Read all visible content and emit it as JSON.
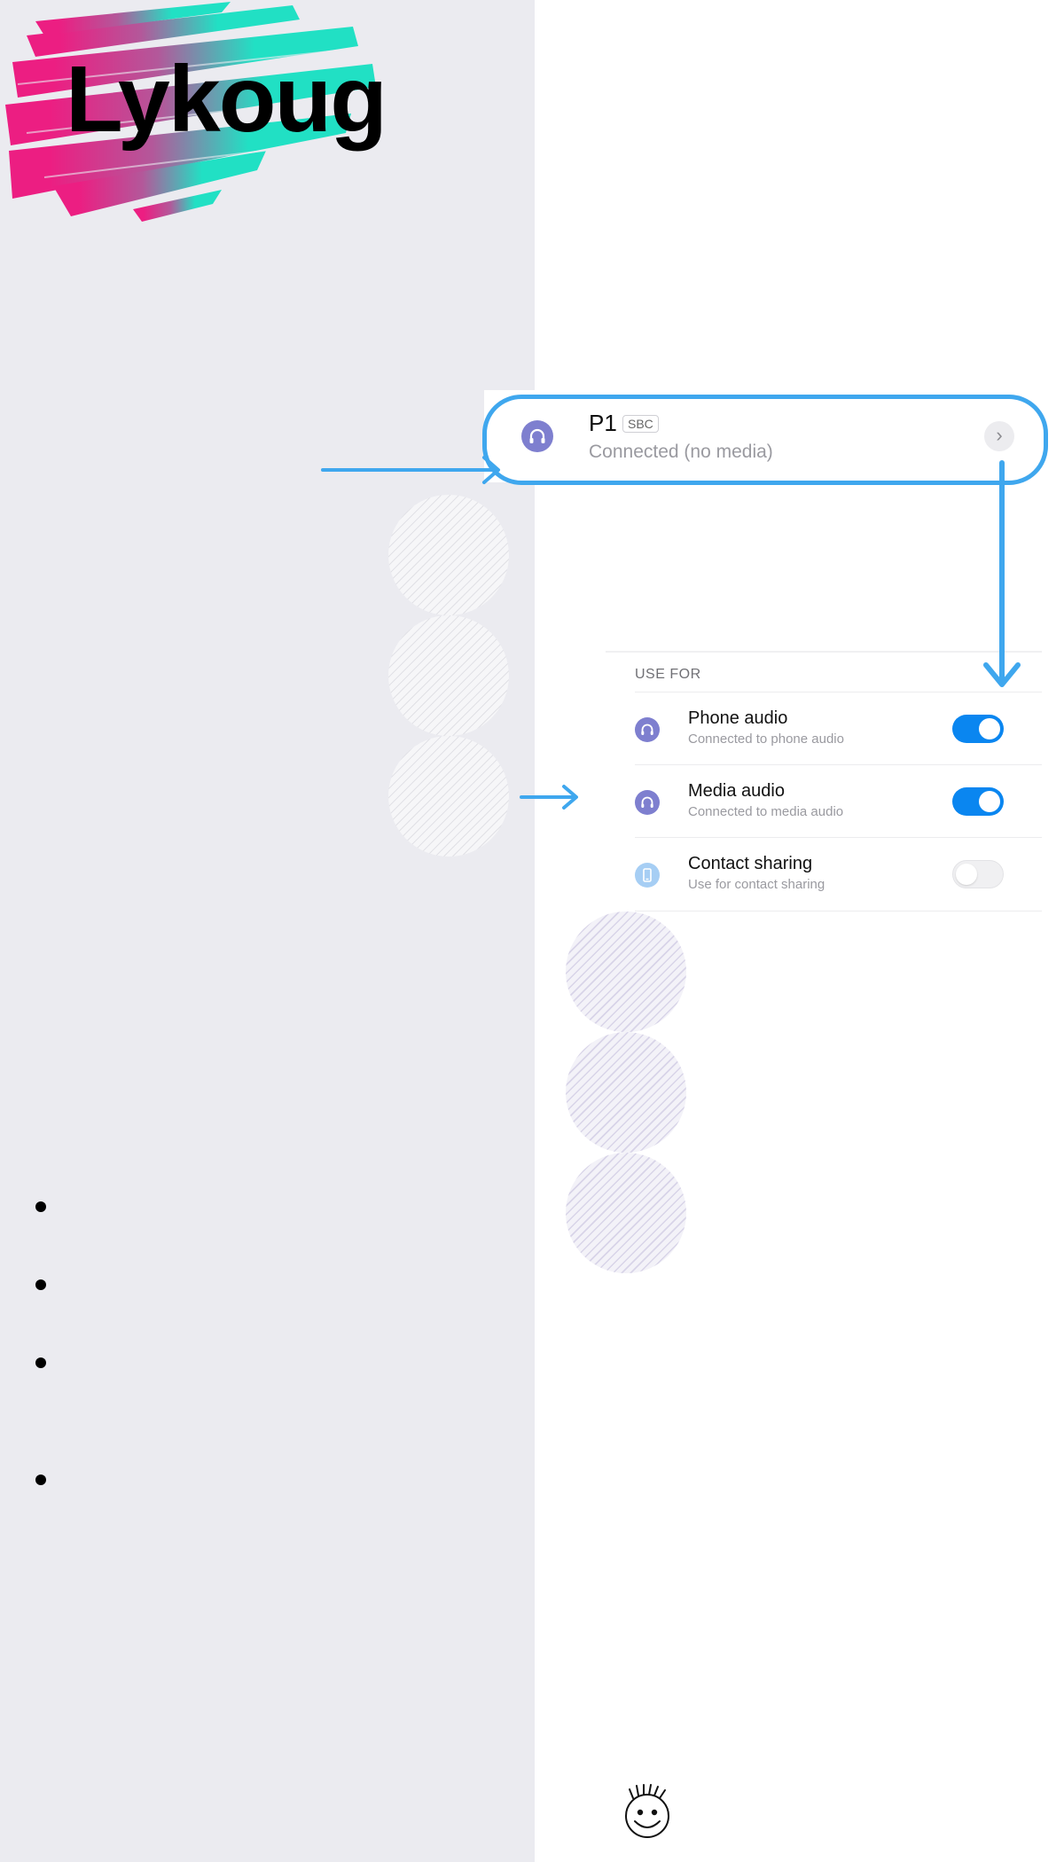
{
  "brand": {
    "title": "Lykoug"
  },
  "device": {
    "name": "P1",
    "codec": "SBC",
    "status": "Connected (no media)",
    "icon": "headset-icon",
    "chevron": "›"
  },
  "use_for": {
    "header": "USE FOR",
    "options": [
      {
        "label": "Phone audio",
        "sub": "Connected to phone audio",
        "enabled": true,
        "icon": "headset-icon"
      },
      {
        "label": "Media audio",
        "sub": "Connected to media audio",
        "enabled": true,
        "icon": "headset-icon"
      },
      {
        "label": "Contact sharing",
        "sub": "Use for contact sharing",
        "enabled": false,
        "icon": "phone-icon"
      }
    ]
  },
  "colors": {
    "accent": "#3fa7ee",
    "toggle_on": "#0a86f0",
    "device_icon": "#7e7fcf",
    "panel_bg": "#ebebf0",
    "brush_pink": "#ec1e82",
    "brush_teal": "#21e0c4"
  }
}
